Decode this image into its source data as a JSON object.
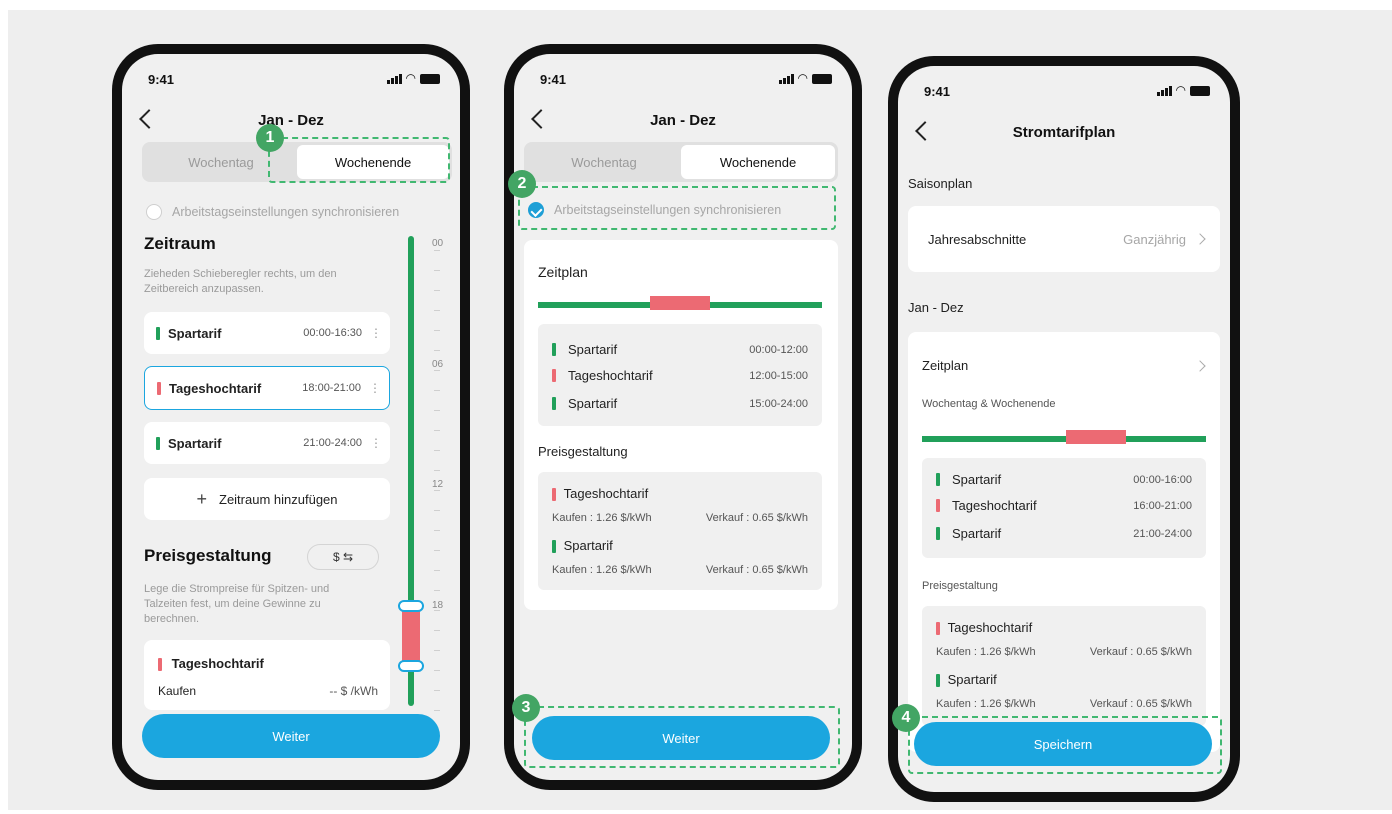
{
  "status": {
    "time": "9:41"
  },
  "phone1": {
    "title": "Jan - Dez",
    "seg": [
      "Wochentag",
      "Wochenende"
    ],
    "sync": "Arbeitstagseinstellungen synchronisieren",
    "zeitraum_heading": "Zeitraum",
    "zeitraum_hint": "Zieheden Schieberegler rechts, um den Zeitbereich anzupassen.",
    "rows": [
      {
        "label": "Spartarif",
        "time": "00:00-16:30"
      },
      {
        "label": "Tageshochtarif",
        "time": "18:00-21:00"
      },
      {
        "label": "Spartarif",
        "time": "21:00-24:00"
      }
    ],
    "add_label": "Zeitraum hinzufügen",
    "preis_heading": "Preisgestaltung",
    "currency_toggle": "$ ⇆",
    "preis_hint": "Lege die Strompreise für Spitzen- und Talzeiten fest, um deine Gewinne zu berechnen.",
    "price_card_title": "Tageshochtarif",
    "kaufen": "Kaufen",
    "kaufen_value": "-- $ /kWh",
    "ticks": [
      "00",
      "06",
      "12",
      "18"
    ],
    "button": "Weiter",
    "slider_range": [
      18,
      21
    ]
  },
  "phone2": {
    "title": "Jan - Dez",
    "seg": [
      "Wochentag",
      "Wochenende"
    ],
    "sync": "Arbeitstagseinstellungen synchronisieren",
    "zeitplan": "Zeitplan",
    "rows": [
      {
        "label": "Spartarif",
        "time": "00:00-12:00"
      },
      {
        "label": "Tageshochtarif",
        "time": "12:00-15:00"
      },
      {
        "label": "Spartarif",
        "time": "15:00-24:00"
      }
    ],
    "preis": "Preisgestaltung",
    "prices": [
      {
        "label": "Tageshochtarif",
        "buy": "Kaufen : 1.26 $/kWh",
        "sell": "Verkauf : 0.65 $/kWh"
      },
      {
        "label": "Spartarif",
        "buy": "Kaufen : 1.26 $/kWh",
        "sell": "Verkauf : 0.65 $/kWh"
      }
    ],
    "button": "Weiter"
  },
  "phone3": {
    "title": "Stromtarifplan",
    "saison": "Saisonplan",
    "jahres": "Jahresabschnitte",
    "jahres_value": "Ganzjährig",
    "jan_dez": "Jan - Dez",
    "zeitplan": "Zeitplan",
    "woche": "Wochentag & Wochenende",
    "rows": [
      {
        "label": "Spartarif",
        "time": "00:00-16:00"
      },
      {
        "label": "Tageshochtarif",
        "time": "16:00-21:00"
      },
      {
        "label": "Spartarif",
        "time": "21:00-24:00"
      }
    ],
    "preis": "Preisgestaltung",
    "prices": [
      {
        "label": "Tageshochtarif",
        "buy": "Kaufen : 1.26 $/kWh",
        "sell": "Verkauf : 0.65 $/kWh"
      },
      {
        "label": "Spartarif",
        "buy": "Kaufen : 1.26 $/kWh",
        "sell": "Verkauf : 0.65 $/kWh"
      }
    ],
    "button": "Speichern"
  },
  "badges": [
    "1",
    "2",
    "3",
    "4"
  ],
  "colors": {
    "green": "#21a05a",
    "red": "#ec6a73",
    "blue": "#1ba6df",
    "dash": "#41b871"
  }
}
